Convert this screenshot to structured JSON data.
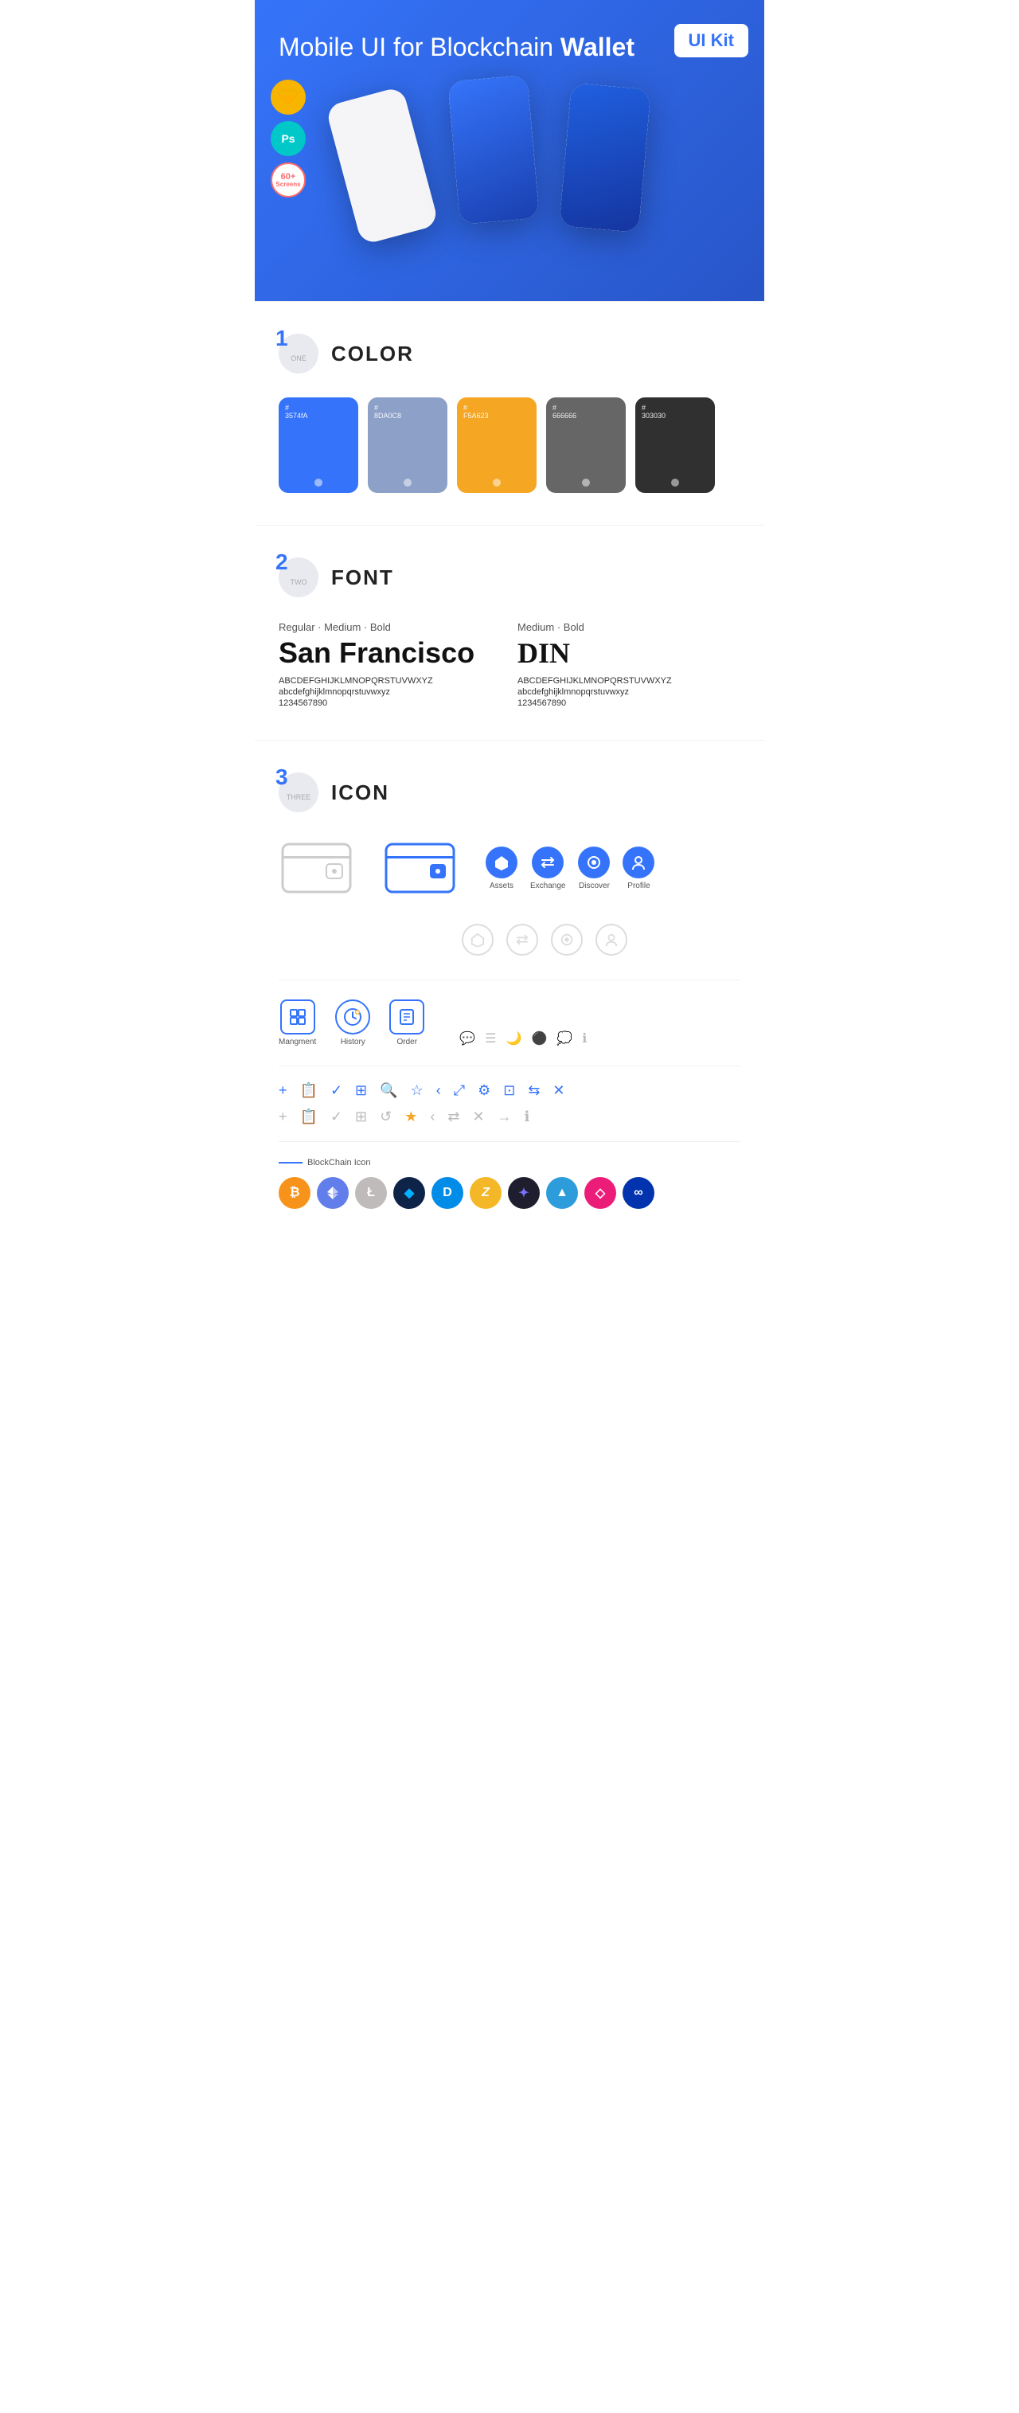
{
  "hero": {
    "title_normal": "Mobile UI for Blockchain ",
    "title_bold": "Wallet",
    "badge": "UI Kit",
    "icons": {
      "sketch": "◆",
      "ps": "Ps",
      "screens": {
        "number": "60+",
        "label": "Screens"
      }
    }
  },
  "sections": {
    "color": {
      "number": "1",
      "label": "ONE",
      "title": "COLOR",
      "swatches": [
        {
          "hex": "#3574FA",
          "code": "#3574fA",
          "dot": true
        },
        {
          "hex": "#8D A0C8",
          "code": "#8DA0C8",
          "dot": true
        },
        {
          "hex": "#F5A623",
          "code": "#F5A623",
          "dot": true
        },
        {
          "hex": "#666666",
          "code": "#666666",
          "dot": true
        },
        {
          "hex": "#303030",
          "code": "#303030",
          "dot": true
        }
      ]
    },
    "font": {
      "number": "2",
      "label": "TWO",
      "title": "FONT",
      "fonts": [
        {
          "meta": "Regular · Medium · Bold",
          "name": "San Francisco",
          "uppercase": "ABCDEFGHIJKLMNOPQRSTUVWXYZ",
          "lowercase": "abcdefghijklmnopqrstuvwxyz",
          "numbers": "1234567890"
        },
        {
          "meta": "Medium · Bold",
          "name": "DIN",
          "uppercase": "ABCDEFGHIJKLMNOPQRSTUVWXYZ",
          "lowercase": "abcdefghijklmnopqrstuvwxyz",
          "numbers": "1234567890"
        }
      ]
    },
    "icon": {
      "number": "3",
      "label": "THREE",
      "title": "ICON",
      "main_icons": [
        {
          "name": "Assets",
          "symbol": "◆"
        },
        {
          "name": "Exchange",
          "symbol": "⇄"
        },
        {
          "name": "Discover",
          "symbol": "●"
        },
        {
          "name": "Profile",
          "symbol": "◯"
        }
      ],
      "nav_icons": [
        {
          "name": "Mangment",
          "symbol": "▤"
        },
        {
          "name": "History",
          "symbol": "🕐"
        },
        {
          "name": "Order",
          "symbol": "☰"
        }
      ],
      "tool_icons_blue": [
        "+",
        "📋",
        "✓",
        "⊞",
        "🔍",
        "☆",
        "<",
        "⤢",
        "⚙",
        "⊡",
        "⇆",
        "✕"
      ],
      "tool_icons_gray": [
        "+",
        "📋",
        "✓",
        "⊞",
        "↺",
        "☆",
        "<",
        "⇄",
        "✕",
        "→",
        "ℹ"
      ],
      "blockchain_label": "BlockChain Icon",
      "crypto_colors": [
        {
          "symbol": "₿",
          "bg": "#F7931A",
          "color": "#fff"
        },
        {
          "symbol": "Ξ",
          "bg": "#627EEA",
          "color": "#fff"
        },
        {
          "symbol": "Ł",
          "bg": "#BFBBBB",
          "color": "#fff"
        },
        {
          "symbol": "◆",
          "bg": "#0D2348",
          "color": "#00B2FF"
        },
        {
          "symbol": "D",
          "bg": "#008CE7",
          "color": "#fff"
        },
        {
          "symbol": "Z",
          "bg": "#F4B728",
          "color": "#fff"
        },
        {
          "symbol": "◈",
          "bg": "#1E1E2E",
          "color": "#7B6FFF"
        },
        {
          "symbol": "▲",
          "bg": "#2D9CDB",
          "color": "#fff"
        },
        {
          "symbol": "◇",
          "bg": "#EC1C79",
          "color": "#fff"
        },
        {
          "symbol": "∞",
          "bg": "#0033AD",
          "color": "#fff"
        }
      ]
    }
  }
}
